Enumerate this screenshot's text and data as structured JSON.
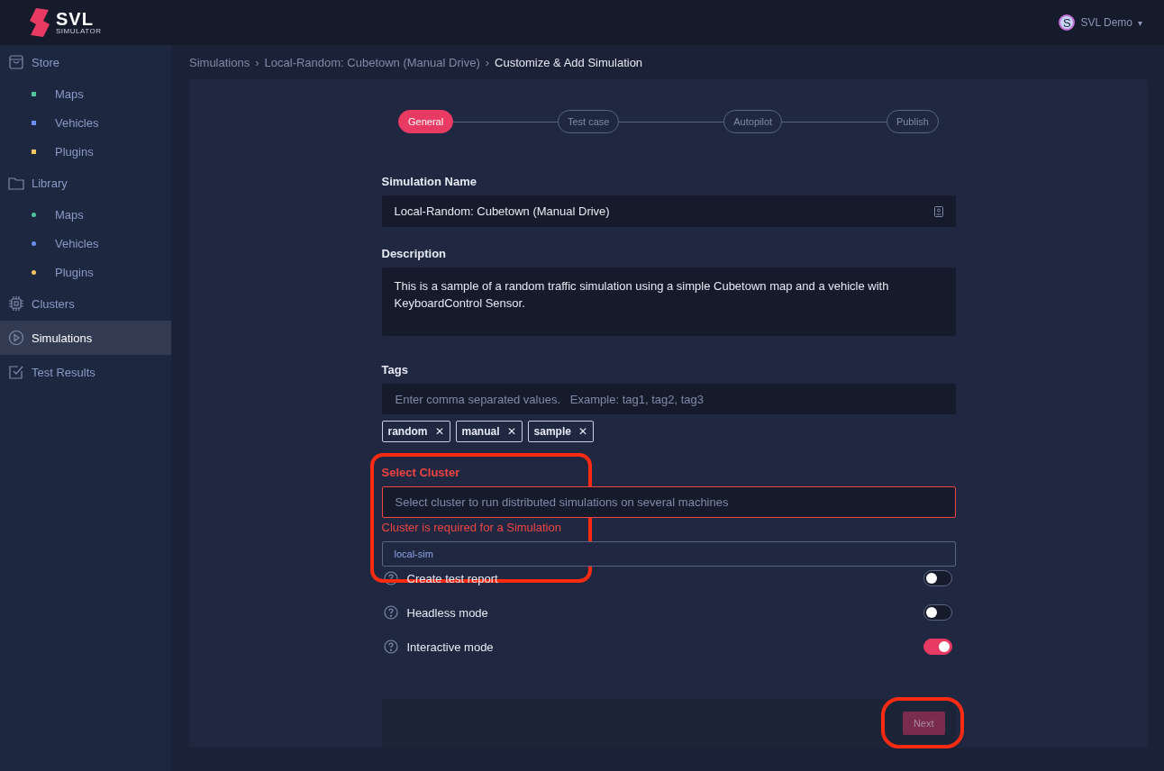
{
  "header": {
    "logo_title": "SVL",
    "logo_subtitle": "SIMULATOR",
    "user": {
      "initial": "S",
      "name": "SVL Demo",
      "caret": "▾"
    }
  },
  "sidebar": {
    "items": [
      {
        "label": "Store",
        "selected": false,
        "children": [
          {
            "label": "Maps",
            "color": "#4fc59a",
            "kind": "square"
          },
          {
            "label": "Vehicles",
            "color": "#6b8ef0",
            "kind": "square"
          },
          {
            "label": "Plugins",
            "color": "#f2c462",
            "kind": "square"
          }
        ]
      },
      {
        "label": "Library",
        "selected": false,
        "children": [
          {
            "label": "Maps",
            "color": "#4fc59a",
            "kind": "dot"
          },
          {
            "label": "Vehicles",
            "color": "#6b8ef0",
            "kind": "dot"
          },
          {
            "label": "Plugins",
            "color": "#f2c462",
            "kind": "dot"
          }
        ]
      },
      {
        "label": "Clusters",
        "selected": false
      },
      {
        "label": "Simulations",
        "selected": true
      },
      {
        "label": "Test Results",
        "selected": false
      }
    ]
  },
  "breadcrumb": [
    {
      "label": "Simulations",
      "current": false
    },
    {
      "label": "Local-Random: Cubetown (Manual Drive)",
      "current": false
    },
    {
      "label": "Customize & Add Simulation",
      "current": true
    }
  ],
  "breadcrumb_separator": "›",
  "steps": [
    {
      "label": "General",
      "selected": true
    },
    {
      "label": "Test case",
      "selected": false
    },
    {
      "label": "Autopilot",
      "selected": false
    },
    {
      "label": "Publish",
      "selected": false
    }
  ],
  "form": {
    "name": {
      "label": "Simulation Name",
      "value": "Local-Random: Cubetown (Manual Drive)"
    },
    "description": {
      "label": "Description",
      "value": "This is a sample of a random traffic simulation using a simple Cubetown map and a vehicle with KeyboardControl Sensor."
    },
    "tags": {
      "label": "Tags",
      "placeholder": "Enter comma separated values.   Example: tag1, tag2, tag3",
      "chips": [
        "random",
        "manual",
        "sample"
      ],
      "remove": "✕"
    },
    "cluster": {
      "label": "Select Cluster",
      "placeholder": "Select cluster to run distributed simulations on several machines",
      "error": "Cluster is required for a Simulation",
      "options": [
        "local-sim"
      ]
    },
    "toggles": [
      {
        "label": "Create test report",
        "on": false
      },
      {
        "label": "Headless mode",
        "on": false
      },
      {
        "label": "Interactive mode",
        "on": true
      }
    ]
  },
  "next_button": {
    "label": "Next",
    "disabled": true
  }
}
